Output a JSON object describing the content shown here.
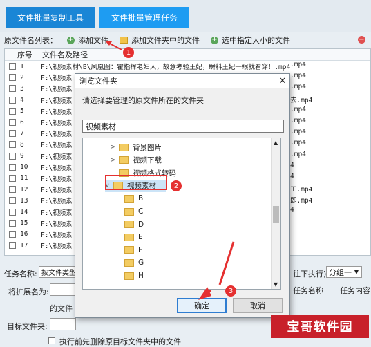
{
  "tabs": [
    {
      "label": "文件批量复制工具"
    },
    {
      "label": "文件批量管理任务"
    }
  ],
  "toolbar": {
    "source_label": "原文件名列表：",
    "add_file": "添加文件",
    "add_folder_files": "添加文件夹中的文件",
    "select_size": "选中指定大小的文件"
  },
  "filelist": {
    "col_num": "序号",
    "col_path": "文件名及路径",
    "rows": [
      {
        "n": "1",
        "p": "F:\\视频素材\\B\\凤凰图：霍指挥老妇人，故意考验王妃，瞬料王妃一眼就看穿！.mp4"
      },
      {
        "n": "2",
        "p": "F:\\视频素"
      },
      {
        "n": "3",
        "p": "F:\\视频素"
      },
      {
        "n": "4",
        "p": "F:\\视频素"
      },
      {
        "n": "5",
        "p": "F:\\视频素"
      },
      {
        "n": "6",
        "p": "F:\\视频素"
      },
      {
        "n": "7",
        "p": "F:\\视频素"
      },
      {
        "n": "8",
        "p": "F:\\视频素"
      },
      {
        "n": "9",
        "p": "F:\\视频素"
      },
      {
        "n": "10",
        "p": "F:\\视频素"
      },
      {
        "n": "11",
        "p": "F:\\视频素"
      },
      {
        "n": "12",
        "p": "F:\\视频素"
      },
      {
        "n": "13",
        "p": "F:\\视频素"
      },
      {
        "n": "14",
        "p": "F:\\视频素"
      },
      {
        "n": "15",
        "p": "F:\\视频素"
      },
      {
        "n": "16",
        "p": "F:\\视频素"
      },
      {
        "n": "17",
        "p": "F:\\视频素"
      }
    ],
    "right_tails": [
      ".mp4",
      ".mp4",
      ".mp4",
      "去.mp4",
      ".mp4",
      ".mp4",
      ".mp4",
      ".mp4",
      ".mp4",
      "4",
      "4",
      "工.mp4",
      "即.mp4",
      "4"
    ]
  },
  "bottom": {
    "task_name_label": "任务名称:",
    "task_name_value": "按文件类型",
    "rename_ext_label": "将扩展名为:",
    "of_file_label": "的文件",
    "target_folder_label": "目标文件夹:",
    "delete_first_label": "执行前先删除原目标文件夹中的文件",
    "exec_label": "往下执行)",
    "group_value": "分组一",
    "col_task_name": "任务名称",
    "col_task_content": "任务内容"
  },
  "dialog": {
    "title": "浏览文件夹",
    "description": "请选择要管理的原文件所在的文件夹",
    "path_value": "视频素材",
    "tree": [
      {
        "label": "背景图片"
      },
      {
        "label": "视频下载"
      },
      {
        "label": "视频格式转码"
      },
      {
        "label": "视频素材"
      },
      {
        "label": "B"
      },
      {
        "label": "C"
      },
      {
        "label": "D"
      },
      {
        "label": "E"
      },
      {
        "label": "F"
      },
      {
        "label": "G"
      },
      {
        "label": "H"
      }
    ],
    "ok": "确定",
    "cancel": "取消"
  },
  "annotations": [
    "1",
    "2",
    "3"
  ],
  "watermark": "宝哥软件园",
  "colors": {
    "accent": "#1e9cf2",
    "annotation": "#e53030"
  }
}
